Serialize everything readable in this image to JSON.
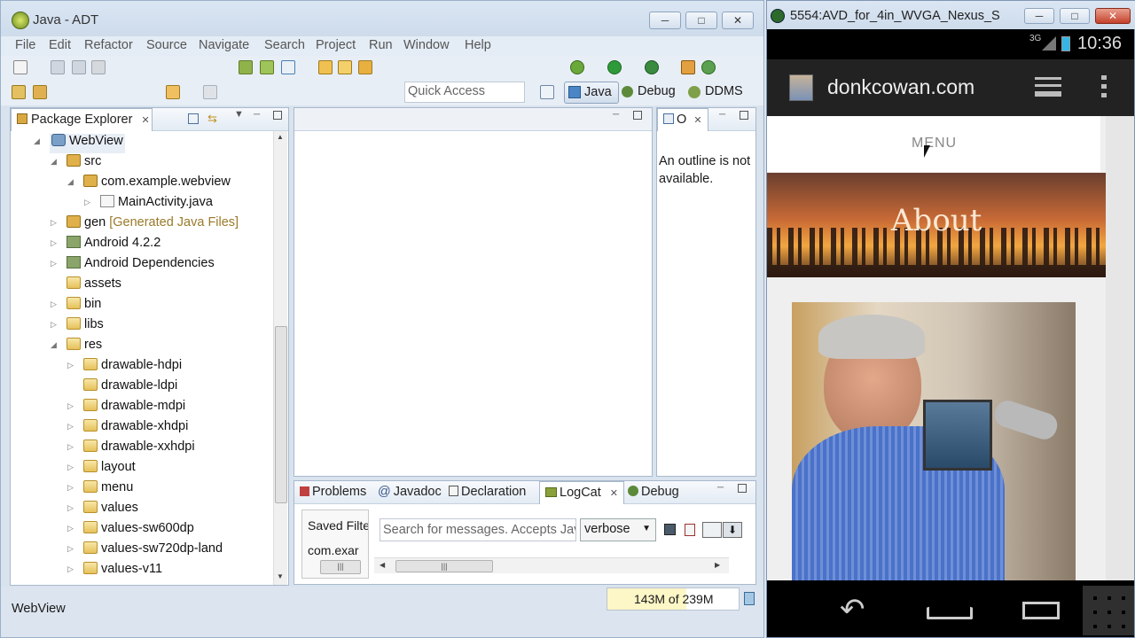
{
  "eclipse": {
    "title": "Java - ADT",
    "menu": [
      "File",
      "Edit",
      "Refactor",
      "Source",
      "Navigate",
      "Search",
      "Project",
      "Run",
      "Window",
      "Help"
    ],
    "quick_access_placeholder": "Quick Access",
    "perspectives": [
      "Java",
      "Debug",
      "DDMS"
    ],
    "package_explorer": {
      "tab_label": "Package Explorer",
      "tree": [
        {
          "label": "WebView",
          "level": 0,
          "expanded": true,
          "icon": "project-icon"
        },
        {
          "label": "src",
          "level": 1,
          "expanded": true,
          "icon": "source-folder-icon"
        },
        {
          "label": "com.example.webview",
          "level": 2,
          "expanded": true,
          "icon": "package-icon"
        },
        {
          "label": "MainActivity.java",
          "level": 3,
          "expanded": false,
          "icon": "java-file-icon"
        },
        {
          "label": "gen",
          "level": 1,
          "expanded": false,
          "icon": "source-folder-icon",
          "suffix": "[Generated Java Files]"
        },
        {
          "label": "Android 4.2.2",
          "level": 1,
          "expanded": false,
          "icon": "library-icon"
        },
        {
          "label": "Android Dependencies",
          "level": 1,
          "expanded": false,
          "icon": "library-icon"
        },
        {
          "label": "assets",
          "level": 1,
          "expanded": null,
          "icon": "folder-icon"
        },
        {
          "label": "bin",
          "level": 1,
          "expanded": false,
          "icon": "folder-icon"
        },
        {
          "label": "libs",
          "level": 1,
          "expanded": false,
          "icon": "folder-icon"
        },
        {
          "label": "res",
          "level": 1,
          "expanded": true,
          "icon": "folder-icon"
        },
        {
          "label": "drawable-hdpi",
          "level": 2,
          "expanded": false,
          "icon": "folder-icon"
        },
        {
          "label": "drawable-ldpi",
          "level": 2,
          "expanded": null,
          "icon": "folder-icon"
        },
        {
          "label": "drawable-mdpi",
          "level": 2,
          "expanded": false,
          "icon": "folder-icon"
        },
        {
          "label": "drawable-xhdpi",
          "level": 2,
          "expanded": false,
          "icon": "folder-icon"
        },
        {
          "label": "drawable-xxhdpi",
          "level": 2,
          "expanded": false,
          "icon": "folder-icon"
        },
        {
          "label": "layout",
          "level": 2,
          "expanded": false,
          "icon": "folder-icon"
        },
        {
          "label": "menu",
          "level": 2,
          "expanded": false,
          "icon": "folder-icon"
        },
        {
          "label": "values",
          "level": 2,
          "expanded": false,
          "icon": "folder-icon"
        },
        {
          "label": "values-sw600dp",
          "level": 2,
          "expanded": false,
          "icon": "folder-icon"
        },
        {
          "label": "values-sw720dp-land",
          "level": 2,
          "expanded": false,
          "icon": "folder-icon"
        },
        {
          "label": "values-v11",
          "level": 2,
          "expanded": false,
          "icon": "folder-icon"
        }
      ]
    },
    "outline": {
      "tab_label": "O",
      "message": "An outline is not available."
    },
    "bottom_tabs": [
      "Problems",
      "Javadoc",
      "Declaration",
      "LogCat",
      "Debug"
    ],
    "logcat": {
      "saved_filters_label": "Saved Filte",
      "filter_item": "com.exar",
      "search_placeholder": "Search for messages. Accepts Jav",
      "level": "verbose"
    },
    "status": {
      "selection": "WebView",
      "heap": "143M of 239M"
    }
  },
  "emulator": {
    "title": "5554:AVD_for_4in_WVGA_Nexus_S",
    "status_bar": {
      "network": "3G",
      "time": "10:36"
    },
    "browser": {
      "site_title": "donkcowan.com",
      "menu_label": "MENU",
      "banner_text": "About"
    }
  }
}
